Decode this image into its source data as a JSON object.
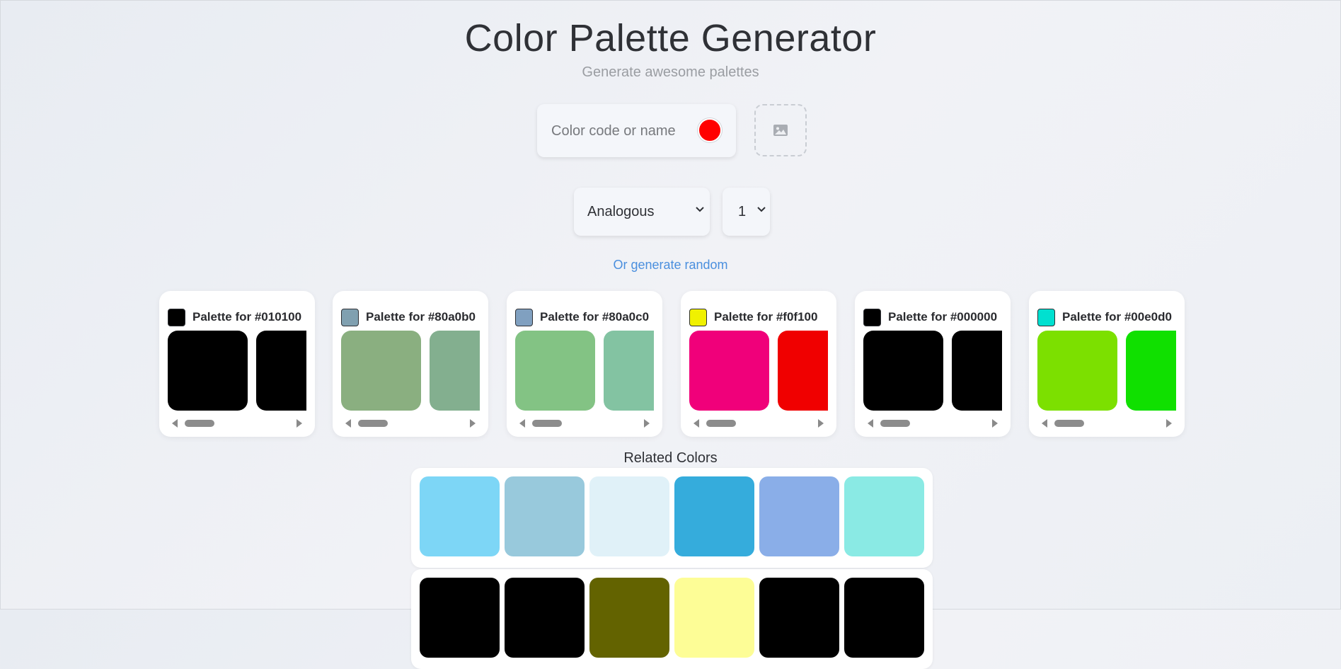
{
  "header": {
    "title": "Color Palette Generator",
    "subtitle": "Generate awesome palettes"
  },
  "color_input": {
    "placeholder": "Color code or name",
    "value": "",
    "swatch_color": "#ff0000"
  },
  "image_upload": {
    "icon": "image-icon"
  },
  "mode_select": {
    "value": "Analogous"
  },
  "count_select": {
    "value": "1"
  },
  "random_link": "Or generate random",
  "palettes": [
    {
      "title": "Palette for #010100",
      "base": "#010100",
      "colors": [
        "#000000",
        "#000000"
      ]
    },
    {
      "title": "Palette for #80a0b0",
      "base": "#80a0b0",
      "colors": [
        "#8aaf80",
        "#83af8f"
      ]
    },
    {
      "title": "Palette for #80a0c0",
      "base": "#80a0c0",
      "colors": [
        "#83c384",
        "#83c3a2"
      ]
    },
    {
      "title": "Palette for #f0f100",
      "base": "#f0f100",
      "colors": [
        "#f0007a",
        "#f00000"
      ]
    },
    {
      "title": "Palette for #000000",
      "base": "#000000",
      "colors": [
        "#000000",
        "#000000"
      ]
    },
    {
      "title": "Palette for #00e0d0",
      "base": "#00e0d0",
      "colors": [
        "#7ce000",
        "#10e000"
      ]
    }
  ],
  "related": {
    "label": "Related Colors",
    "rows": [
      [
        "#7dd6f6",
        "#98c9dc",
        "#e0f1f8",
        "#35acdc",
        "#8aaee8",
        "#8aeae4"
      ],
      [
        "#000000",
        "#000000",
        "#636300",
        "#fdfd96",
        "#000000",
        "#000000"
      ]
    ]
  }
}
